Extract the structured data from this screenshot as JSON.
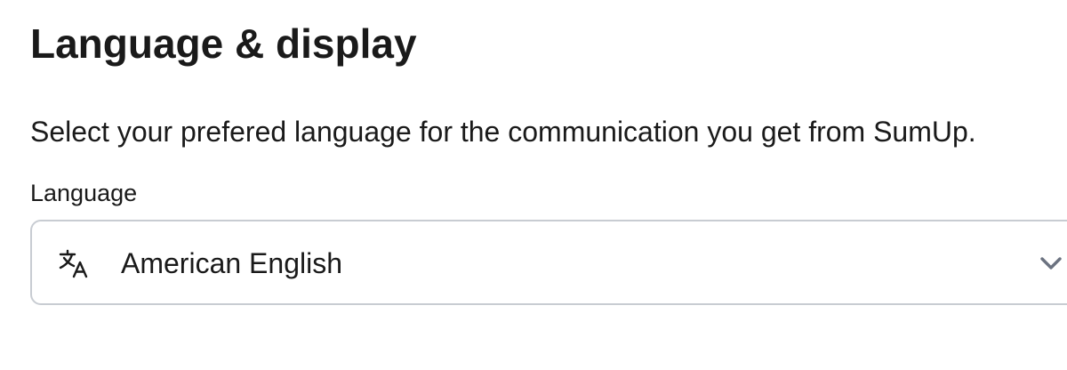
{
  "page": {
    "title": "Language & display",
    "description": "Select your prefered language for the communication you get from SumUp."
  },
  "language_field": {
    "label": "Language",
    "selected_value": "American English",
    "leading_icon": "translate-icon",
    "trailing_icon": "chevron-down-icon"
  },
  "colors": {
    "text": "#1a1a1a",
    "border": "#c8ccd2",
    "chevron": "#6b7280",
    "background": "#ffffff"
  }
}
